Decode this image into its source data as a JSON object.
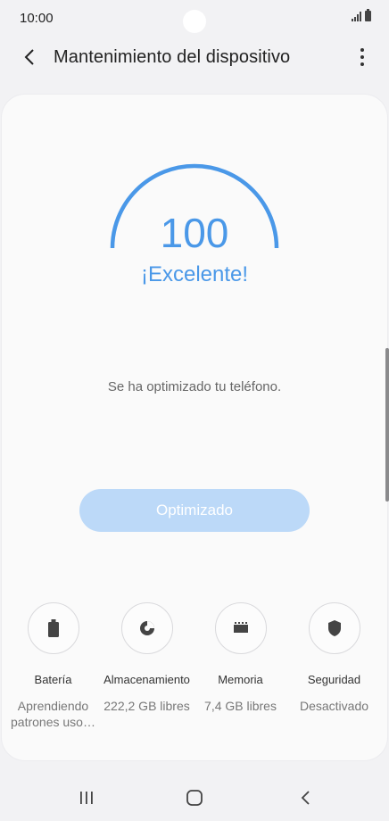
{
  "status_bar": {
    "time": "10:00"
  },
  "app_bar": {
    "title": "Mantenimiento del dispositivo"
  },
  "score": {
    "value": "100",
    "rating": "¡Excelente!",
    "fraction": 1.0
  },
  "message": "Se ha optimizado tu teléfono.",
  "primary_button": {
    "label": "Optimizado"
  },
  "tiles": [
    {
      "label": "Batería",
      "value": "Aprendiendo patrones uso…",
      "icon": "battery-icon"
    },
    {
      "label": "Almacenamiento",
      "value": "222,2 GB libres",
      "icon": "pie-chart-icon"
    },
    {
      "label": "Memoria",
      "value": "7,4 GB libres",
      "icon": "memory-chip-icon"
    },
    {
      "label": "Seguridad",
      "value": "Desactivado",
      "icon": "shield-icon"
    }
  ],
  "colors": {
    "accent": "#4a98e8",
    "button_disabled": "#bcd9f8",
    "background": "#f2f2f4"
  }
}
